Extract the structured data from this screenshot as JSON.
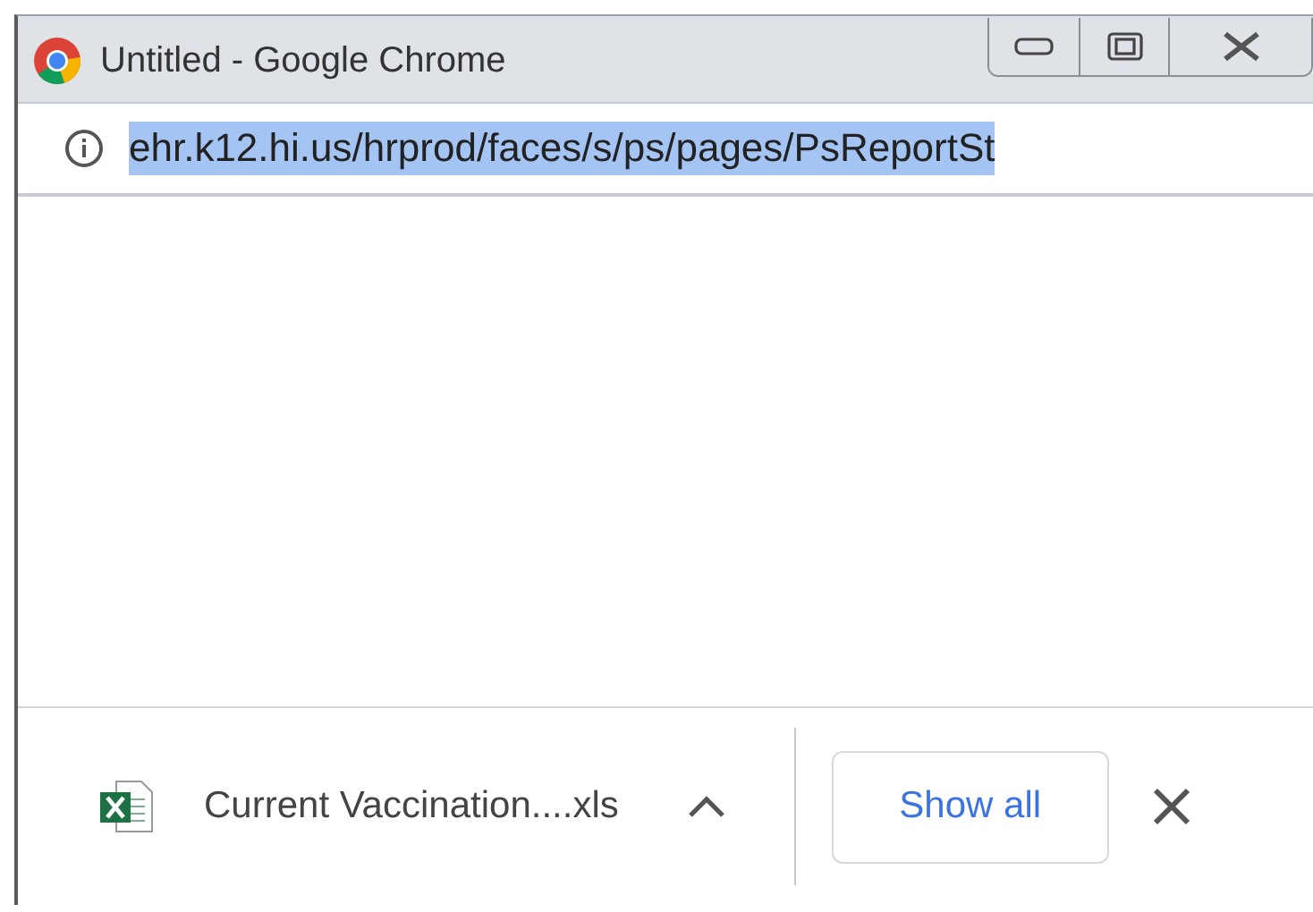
{
  "window": {
    "title": "Untitled - Google Chrome"
  },
  "address_bar": {
    "url": "ehr.k12.hi.us/hrprod/faces/s/ps/pages/PsReportSt",
    "selected": true
  },
  "download_shelf": {
    "file_name": "Current Vaccination....xls",
    "show_all": "Show all"
  }
}
